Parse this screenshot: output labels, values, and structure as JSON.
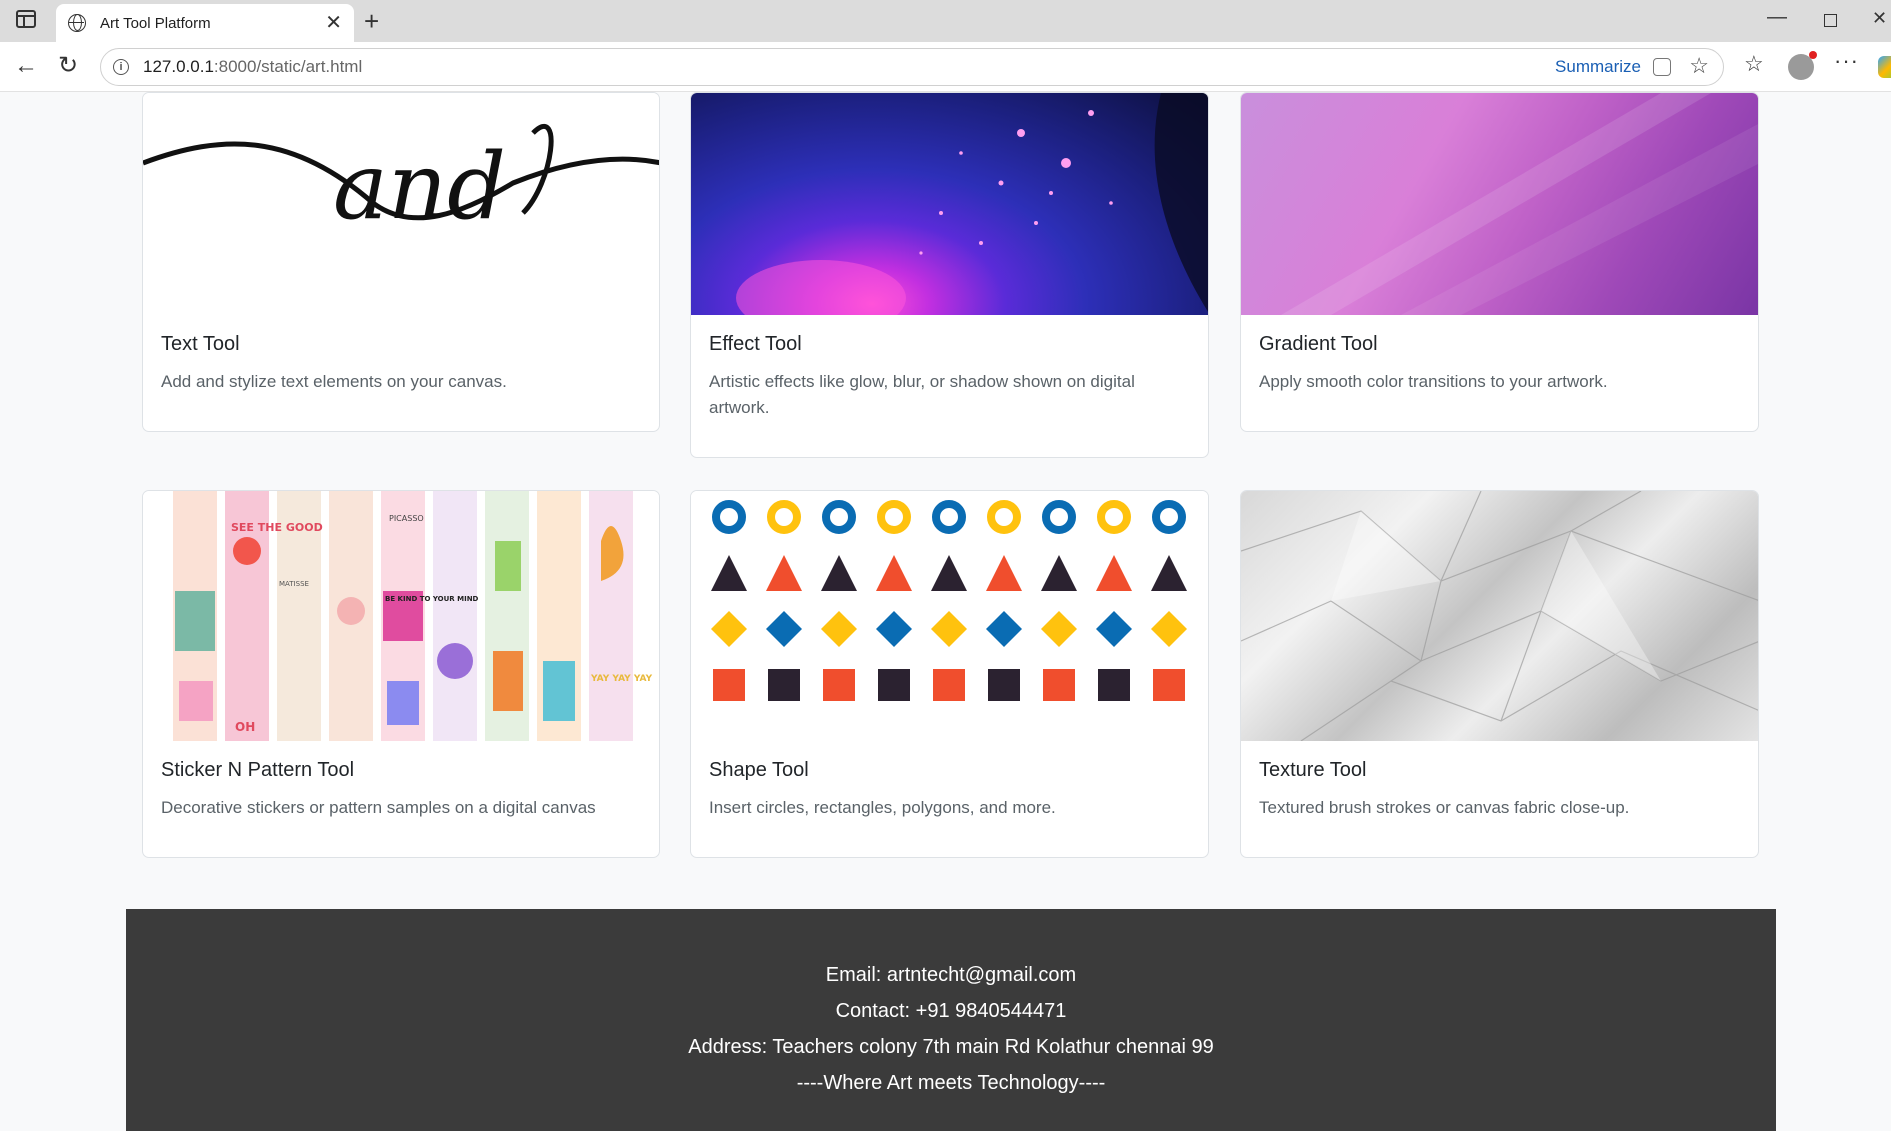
{
  "browser": {
    "tab_title": "Art Tool Platform",
    "url_host": "127.0.0.1",
    "url_path": ":8000/static/art.html",
    "summarize_label": "Summarize"
  },
  "cards": [
    {
      "title": "Text Tool",
      "description": "Add and stylize text elements on your canvas.",
      "image_text": "and"
    },
    {
      "title": "Effect Tool",
      "description": "Artistic effects like glow, blur, or shadow shown on digital artwork."
    },
    {
      "title": "Gradient Tool",
      "description": "Apply smooth color transitions to your artwork."
    },
    {
      "title": "Sticker N Pattern Tool",
      "description": "Decorative stickers or pattern samples on a digital canvas",
      "sticker_words": [
        "SEE THE GOOD",
        "PICASSO",
        "BE KIND TO YOUR MIND",
        "MATISSE",
        "YAY YAY YAY",
        "OH"
      ]
    },
    {
      "title": "Shape Tool",
      "description": "Insert circles, rectangles, polygons, and more."
    },
    {
      "title": "Texture Tool",
      "description": "Textured brush strokes or canvas fabric close-up."
    }
  ],
  "footer": {
    "email": "Email: artntecht@gmail.com",
    "contact": "Contact: +91 9840544471",
    "address": "Address: Teachers colony 7th main Rd Kolathur chennai 99",
    "tagline": "----Where Art meets Technology----"
  },
  "colors": {
    "footer_bg": "#3b3b3b",
    "link_blue": "#1a5fb4",
    "shape_blue": "#0a6cb3",
    "shape_red": "#f04e2d",
    "shape_yellow": "#ffc20e",
    "shape_dark": "#2b2230"
  }
}
